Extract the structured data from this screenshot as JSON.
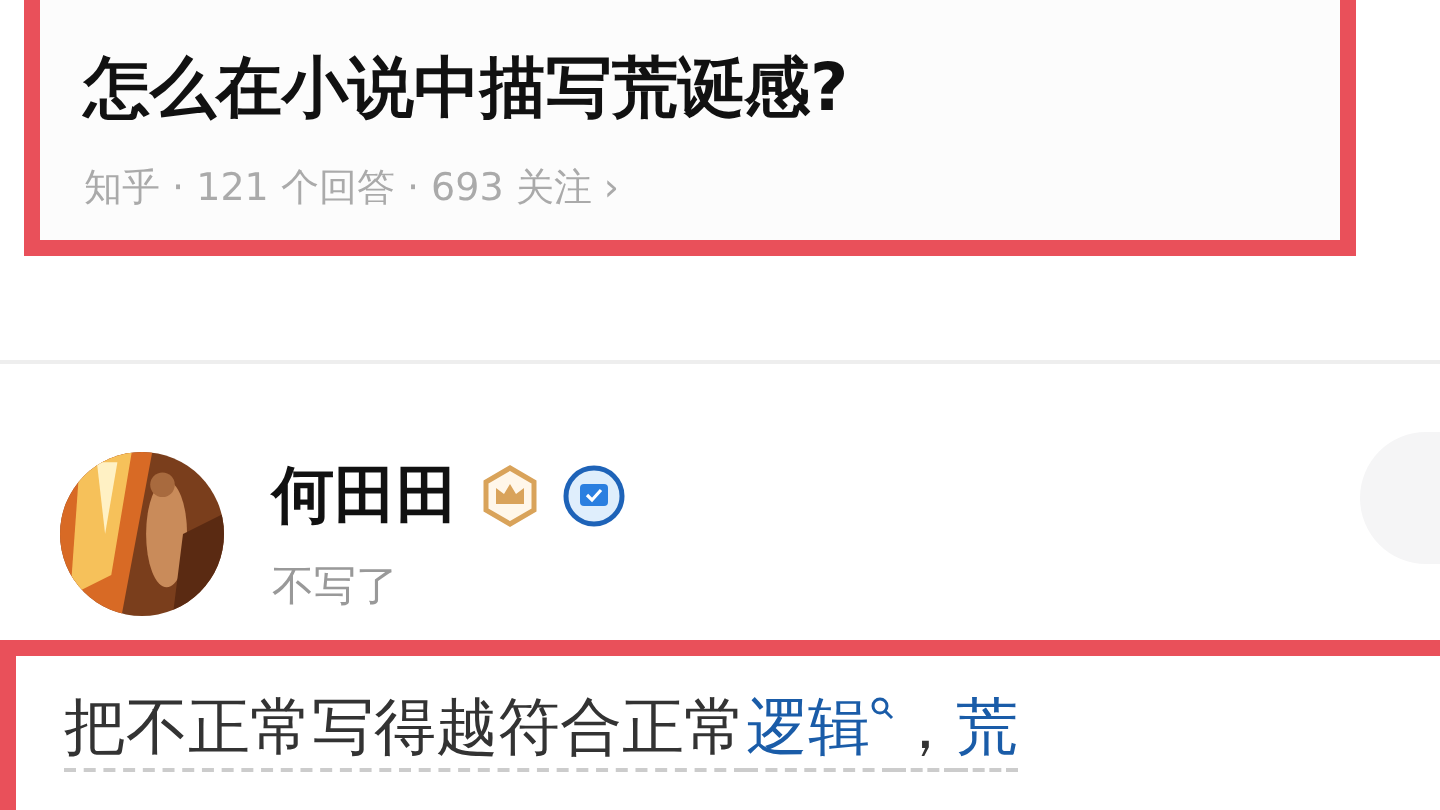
{
  "question": {
    "title": "怎么在小说中描写荒诞感?",
    "meta": "知乎 · 121 个回答 · 693 关注 ›"
  },
  "author": {
    "name": "何田田",
    "bio": "不写了"
  },
  "answer": [
    {
      "kind": "plain",
      "text": "把不正常写得越符合正常"
    },
    {
      "kind": "link",
      "text": "逻辑",
      "after": "，"
    },
    {
      "kind": "link",
      "text": "荒"
    }
  ]
}
